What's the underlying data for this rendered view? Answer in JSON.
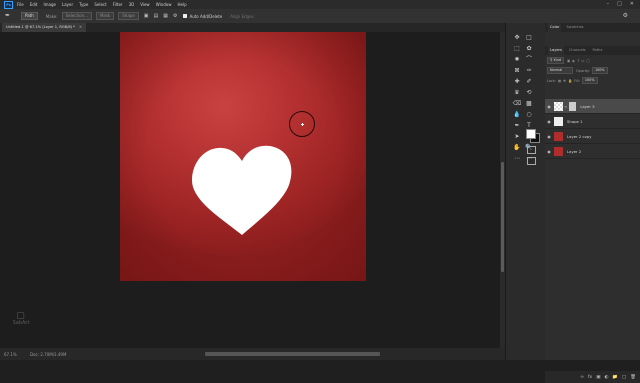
{
  "menubar": {
    "logo": "Ps",
    "items": [
      "File",
      "Edit",
      "Image",
      "Layer",
      "Type",
      "Select",
      "Filter",
      "3D",
      "View",
      "Window",
      "Help"
    ]
  },
  "options": {
    "mode_label": "Path",
    "make_label": "Make:",
    "selection_label": "Selection...",
    "mask_label": "Mask",
    "shape_label": "Shape",
    "auto_add_delete": "Auto Add/Delete",
    "align_edges": "Align Edges"
  },
  "document": {
    "tab_title": "Untitled-1 @ 67.1% (Layer 1, RGB/8) *",
    "zoom": "67.1%",
    "doc_info": "Doc: 2.70M/3.49M",
    "canvas_color": "#b83333",
    "heart_color": "#ffffff"
  },
  "tools": [
    "move",
    "marquee",
    "lasso",
    "magic-wand",
    "crop",
    "frame",
    "eyedropper",
    "healing",
    "brush",
    "stamp",
    "history-brush",
    "eraser",
    "gradient",
    "blur",
    "dodge",
    "pen",
    "type",
    "path-select",
    "shape",
    "hand",
    "zoom",
    "more"
  ],
  "color_panel": {
    "tabs": [
      "Color",
      "Swatches"
    ]
  },
  "layers_panel": {
    "tabs": [
      "Layers",
      "Channels",
      "Paths"
    ],
    "kind_label": "Kind",
    "blend_mode": "Normal",
    "opacity_label": "Opacity:",
    "opacity_value": "100%",
    "lock_label": "Lock:",
    "fill_label": "Fill:",
    "fill_value": "100%",
    "layers": [
      {
        "name": "Layer 3",
        "selected": true
      },
      {
        "name": "Shape 1",
        "selected": false
      },
      {
        "name": "Layer 2 copy",
        "selected": false
      },
      {
        "name": "Layer 2",
        "selected": false
      }
    ]
  },
  "watermark": {
    "text": "SabArt"
  }
}
